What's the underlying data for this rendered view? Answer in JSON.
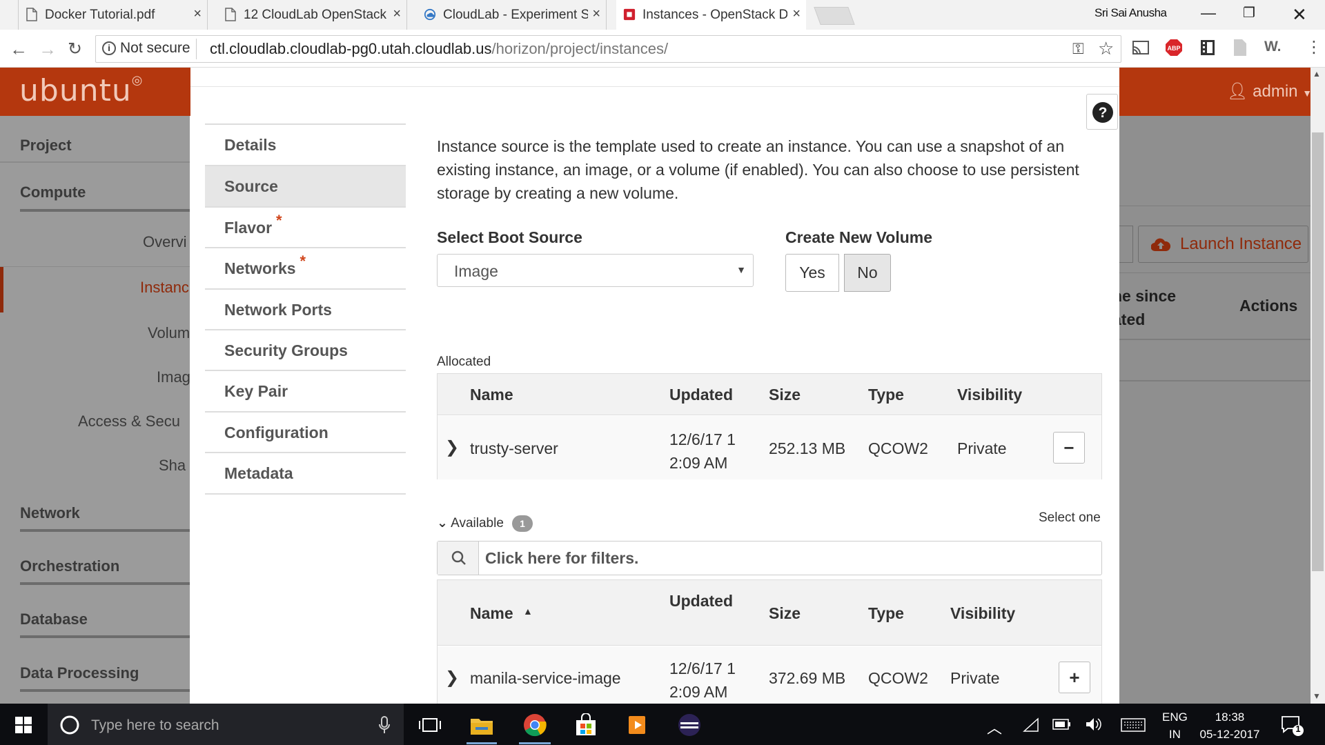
{
  "browser": {
    "tabs": [
      {
        "title": "Docker Tutorial.pdf",
        "icon": "document-icon",
        "active": false
      },
      {
        "title": "12 CloudLab OpenStack",
        "icon": "document-icon",
        "active": false
      },
      {
        "title": "CloudLab - Experiment S",
        "icon": "cloudlab-icon",
        "active": false
      },
      {
        "title": "Instances - OpenStack D",
        "icon": "openstack-icon",
        "active": true
      }
    ],
    "user_name": "Sri Sai Anusha",
    "security_label": "Not secure",
    "url_host": "ctl.cloudlab.cloudlab-pg0.utah.cloudlab.us",
    "url_path": "/horizon/project/instances/"
  },
  "dashboard": {
    "brand": "ubuntu",
    "user_menu": "admin",
    "sidebar": {
      "project": "Project",
      "compute": "Compute",
      "items": [
        "Overvi",
        "Instanc",
        "Volum",
        "Imag",
        "Access & Secu",
        "Sha"
      ],
      "network": "Network",
      "orchestration": "Orchestration",
      "database": "Database",
      "data_processing": "Data Processing"
    },
    "launch_instance": "Launch Instance",
    "table_headers": {
      "time_since_line1": "ne since",
      "time_since_line2": "ated",
      "actions": "Actions"
    }
  },
  "modal": {
    "steps": [
      {
        "label": "Details",
        "required": false,
        "active": false
      },
      {
        "label": "Source",
        "required": false,
        "active": true
      },
      {
        "label": "Flavor",
        "required": true,
        "active": false
      },
      {
        "label": "Networks",
        "required": true,
        "active": false
      },
      {
        "label": "Network Ports",
        "required": false,
        "active": false
      },
      {
        "label": "Security Groups",
        "required": false,
        "active": false
      },
      {
        "label": "Key Pair",
        "required": false,
        "active": false
      },
      {
        "label": "Configuration",
        "required": false,
        "active": false
      },
      {
        "label": "Metadata",
        "required": false,
        "active": false
      }
    ],
    "required_marker": "*",
    "description": "Instance source is the template used to create an instance. You can use a snapshot of an existing instance, an image, or a volume (if enabled). You can also choose to use persistent storage by creating a new volume.",
    "boot_source_label": "Select Boot Source",
    "boot_source_value": "Image",
    "create_volume_label": "Create New Volume",
    "yes_label": "Yes",
    "no_label": "No",
    "allocated_label": "Allocated",
    "columns": {
      "name": "Name",
      "updated": "Updated",
      "size": "Size",
      "type": "Type",
      "visibility": "Visibility"
    },
    "allocated_rows": [
      {
        "name": "trusty-server",
        "updated_line1": "12/6/17 1",
        "updated_line2": "2:09 AM",
        "size": "252.13 MB",
        "type": "QCOW2",
        "visibility": "Private",
        "action": "−"
      }
    ],
    "available_label": "Available",
    "available_count": "1",
    "select_one": "Select one",
    "filter_placeholder": "Click here for filters.",
    "available_rows": [
      {
        "name": "manila-service-image",
        "updated_line1": "12/6/17 1",
        "updated_line2": "2:09 AM",
        "size": "372.69 MB",
        "type": "QCOW2",
        "visibility": "Private",
        "action": "+"
      }
    ]
  },
  "taskbar": {
    "search_placeholder": "Type here to search",
    "language_line1": "ENG",
    "language_line2": "IN",
    "time": "18:38",
    "date": "05-12-2017",
    "notification_count": "1"
  },
  "colors": {
    "brand_orange": "#b4370e",
    "required_red": "#d0451b",
    "launch_text": "#8f2a0b"
  }
}
